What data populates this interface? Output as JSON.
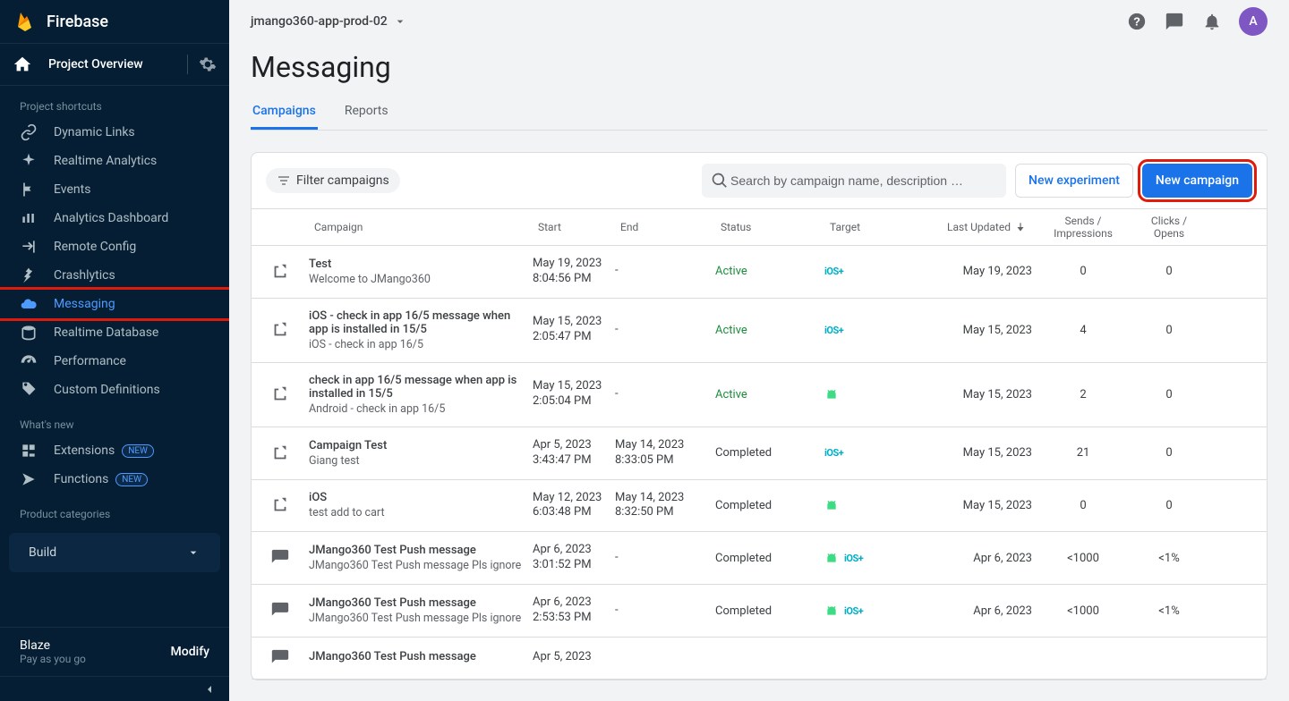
{
  "brand": "Firebase",
  "overview_label": "Project Overview",
  "project_name": "jmango360-app-prod-02",
  "topbar": {
    "avatar_letter": "A"
  },
  "sidebar": {
    "shortcuts_title": "Project shortcuts",
    "items1": [
      {
        "label": "Dynamic Links",
        "icon": "link"
      },
      {
        "label": "Realtime Analytics",
        "icon": "spark"
      },
      {
        "label": "Events",
        "icon": "flag"
      },
      {
        "label": "Analytics Dashboard",
        "icon": "bars"
      },
      {
        "label": "Remote Config",
        "icon": "remote"
      },
      {
        "label": "Crashlytics",
        "icon": "crash"
      },
      {
        "label": "Messaging",
        "icon": "cloud",
        "active": true,
        "highlight": true
      },
      {
        "label": "Realtime Database",
        "icon": "db"
      },
      {
        "label": "Performance",
        "icon": "gauge"
      },
      {
        "label": "Custom Definitions",
        "icon": "price"
      }
    ],
    "whatsnew_title": "What's new",
    "items2": [
      {
        "label": "Extensions",
        "icon": "ext",
        "badge": "NEW"
      },
      {
        "label": "Functions",
        "icon": "fn",
        "badge": "NEW"
      }
    ],
    "categories_title": "Product categories",
    "build_label": "Build"
  },
  "plan": {
    "name": "Blaze",
    "sub": "Pay as you go",
    "modify": "Modify"
  },
  "page": {
    "title": "Messaging",
    "tabs": [
      {
        "label": "Campaigns",
        "active": true
      },
      {
        "label": "Reports",
        "active": false
      }
    ]
  },
  "toolbar": {
    "filter_label": "Filter campaigns",
    "search_placeholder": "Search by campaign name, description …",
    "new_experiment": "New experiment",
    "new_campaign": "New campaign"
  },
  "columns": {
    "campaign": "Campaign",
    "start": "Start",
    "end": "End",
    "status": "Status",
    "target": "Target",
    "updated": "Last Updated",
    "sends": "Sends / Impressions",
    "clicks": "Clicks / Opens"
  },
  "status_labels": {
    "active": "Active",
    "completed": "Completed"
  },
  "rows": [
    {
      "kind": "inapp",
      "title": "Test",
      "sub": "Welcome to JMango360",
      "start": "May 19, 2023 8:04:56 PM",
      "end": "-",
      "status": "active",
      "targets": [
        "ios"
      ],
      "updated": "May 19, 2023",
      "sends": "0",
      "clicks": "0"
    },
    {
      "kind": "inapp",
      "title": "iOS - check in app 16/5 message when app is installed in 15/5",
      "sub": "iOS - check in app 16/5",
      "start": "May 15, 2023 2:05:47 PM",
      "end": "-",
      "status": "active",
      "targets": [
        "ios"
      ],
      "updated": "May 15, 2023",
      "sends": "4",
      "clicks": "0"
    },
    {
      "kind": "inapp",
      "title": "check in app 16/5 message when app is installed in 15/5",
      "sub": "Android - check in app 16/5",
      "start": "May 15, 2023 2:05:04 PM",
      "end": "-",
      "status": "active",
      "targets": [
        "android"
      ],
      "updated": "May 15, 2023",
      "sends": "2",
      "clicks": "0"
    },
    {
      "kind": "inapp",
      "title": "Campaign Test",
      "sub": "Giang test",
      "start": "Apr 5, 2023 3:43:47 PM",
      "end": "May 14, 2023 8:33:05 PM",
      "status": "completed",
      "targets": [
        "ios"
      ],
      "updated": "May 15, 2023",
      "sends": "21",
      "clicks": "0"
    },
    {
      "kind": "inapp",
      "title": "iOS",
      "sub": "test add to cart",
      "start": "May 12, 2023 6:03:48 PM",
      "end": "May 14, 2023 8:32:50 PM",
      "status": "completed",
      "targets": [
        "android"
      ],
      "updated": "May 15, 2023",
      "sends": "0",
      "clicks": "0"
    },
    {
      "kind": "push",
      "title": "JMango360 Test Push message",
      "sub": "JMango360 Test Push message Pls ignore",
      "start": "Apr 6, 2023 3:01:52 PM",
      "end": "-",
      "status": "completed",
      "targets": [
        "android",
        "ios"
      ],
      "updated": "Apr 6, 2023",
      "sends": "<1000",
      "clicks": "<1%"
    },
    {
      "kind": "push",
      "title": "JMango360 Test Push message",
      "sub": "JMango360 Test Push message Pls ignore",
      "start": "Apr 6, 2023 2:53:53 PM",
      "end": "-",
      "status": "completed",
      "targets": [
        "android",
        "ios"
      ],
      "updated": "Apr 6, 2023",
      "sends": "<1000",
      "clicks": "<1%"
    },
    {
      "kind": "push",
      "title": "JMango360 Test Push message",
      "sub": "",
      "start": "Apr 5, 2023",
      "end": "",
      "status": "",
      "targets": [],
      "updated": "",
      "sends": "",
      "clicks": ""
    }
  ]
}
